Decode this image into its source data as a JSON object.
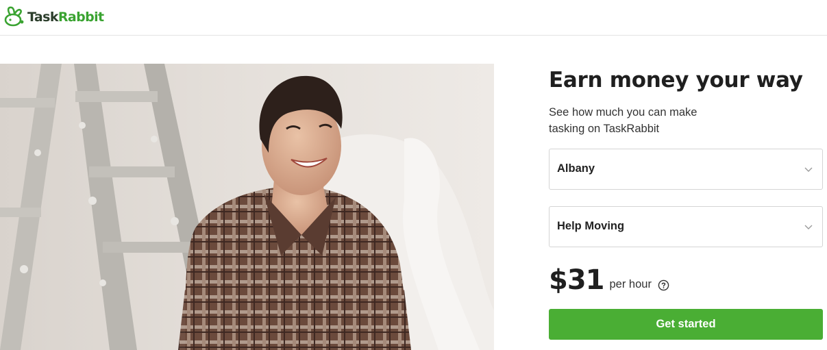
{
  "brand": {
    "logo_icon": "rabbit-logo-icon",
    "name_part1": "Task",
    "name_part2": "Rabbit",
    "green": "#3aa331",
    "dark": "#2c3e2c"
  },
  "hero": {
    "image": "woman-smiling-beside-ladder-photo"
  },
  "panel": {
    "headline": "Earn money your way",
    "subtext_line1": "See how much you can make",
    "subtext_line2": "tasking on TaskRabbit",
    "city_select": {
      "value": "Albany",
      "icon": "chevron-down-icon"
    },
    "category_select": {
      "value": "Help Moving",
      "icon": "chevron-down-icon"
    },
    "price": "$31",
    "price_unit": "per hour",
    "help_icon": "question-circle-icon",
    "cta_label": "Get started",
    "cta_color": "#4aae34"
  }
}
